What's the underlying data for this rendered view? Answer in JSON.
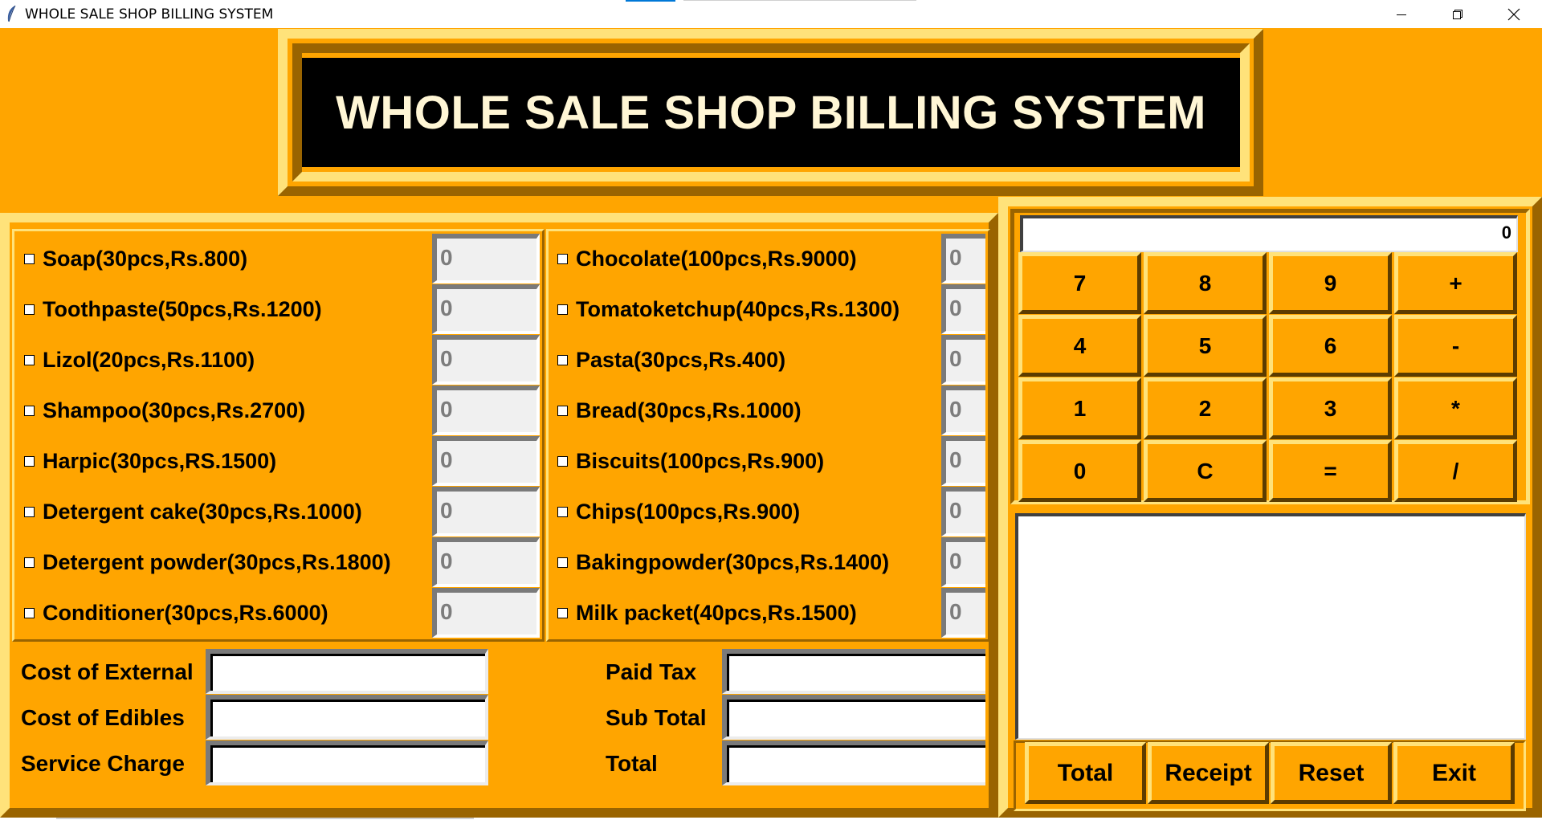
{
  "window": {
    "title": "WHOLE SALE SHOP BILLING SYSTEM",
    "controls": [
      "minimize-icon",
      "restore-icon",
      "close-icon"
    ]
  },
  "header": {
    "title": "WHOLE SALE SHOP BILLING SYSTEM"
  },
  "external_items": [
    {
      "label": "Soap(30pcs,Rs.800)",
      "qty": "0"
    },
    {
      "label": "Toothpaste(50pcs,Rs.1200)",
      "qty": "0"
    },
    {
      "label": "Lizol(20pcs,Rs.1100)",
      "qty": "0"
    },
    {
      "label": "Shampoo(30pcs,Rs.2700)",
      "qty": "0"
    },
    {
      "label": "Harpic(30pcs,RS.1500)",
      "qty": "0"
    },
    {
      "label": "Detergent cake(30pcs,Rs.1000)",
      "qty": "0"
    },
    {
      "label": "Detergent powder(30pcs,Rs.1800)",
      "qty": "0"
    },
    {
      "label": "Conditioner(30pcs,Rs.6000)",
      "qty": "0"
    }
  ],
  "edible_items": [
    {
      "label": "Chocolate(100pcs,Rs.9000)",
      "qty": "0"
    },
    {
      "label": "Tomatoketchup(40pcs,Rs.1300)",
      "qty": "0"
    },
    {
      "label": "Pasta(30pcs,Rs.400)",
      "qty": "0"
    },
    {
      "label": "Bread(30pcs,Rs.1000)",
      "qty": "0"
    },
    {
      "label": "Biscuits(100pcs,Rs.900)",
      "qty": "0"
    },
    {
      "label": "Chips(100pcs,Rs.900)",
      "qty": "0"
    },
    {
      "label": "Bakingpowder(30pcs,Rs.1400)",
      "qty": "0"
    },
    {
      "label": "Milk packet(40pcs,Rs.1500)",
      "qty": "0"
    }
  ],
  "costs_left": [
    {
      "label": "Cost of External",
      "value": ""
    },
    {
      "label": "Cost of Edibles",
      "value": ""
    },
    {
      "label": "Service Charge",
      "value": ""
    }
  ],
  "costs_right": [
    {
      "label": "Paid Tax",
      "value": ""
    },
    {
      "label": "Sub Total",
      "value": ""
    },
    {
      "label": "Total",
      "value": ""
    }
  ],
  "calculator": {
    "display": "0",
    "keys": [
      "7",
      "8",
      "9",
      "+",
      "4",
      "5",
      "6",
      "-",
      "1",
      "2",
      "3",
      "*",
      "0",
      "C",
      "=",
      "/"
    ]
  },
  "receipt": {
    "text": ""
  },
  "actions": [
    "Total",
    "Receipt",
    "Reset",
    "Exit"
  ],
  "colors": {
    "background": "#ffa500",
    "title_bg": "#000000",
    "title_text": "#fff6d5"
  }
}
